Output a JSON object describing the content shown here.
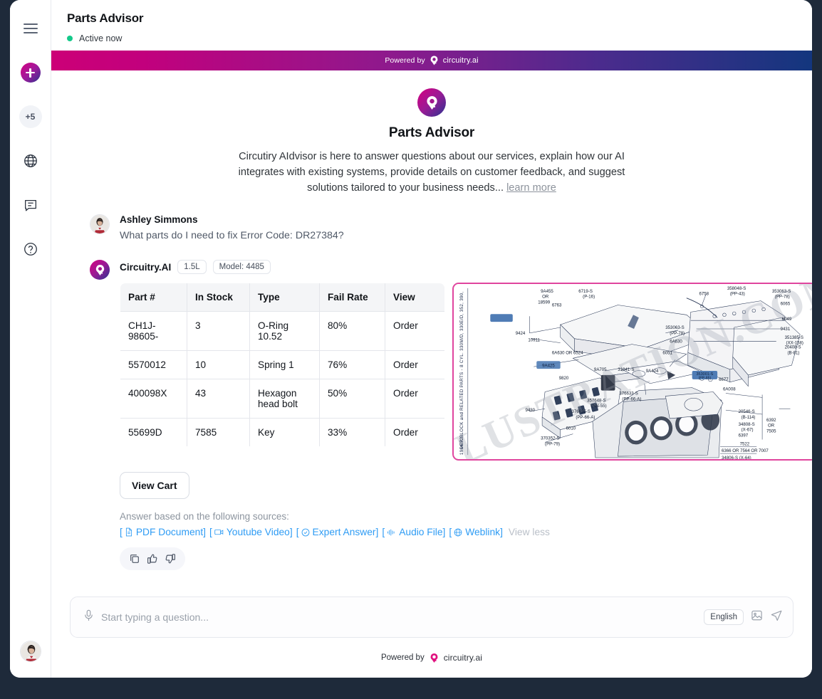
{
  "sidebar": {
    "items": [
      {
        "name": "menu",
        "icon": "hamburger-icon",
        "label": ""
      },
      {
        "name": "new-chat",
        "icon": "plus-icon",
        "label": ""
      },
      {
        "name": "more-count",
        "icon": "count-badge",
        "label": "+5"
      },
      {
        "name": "language",
        "icon": "globe-icon",
        "label": ""
      },
      {
        "name": "conversations",
        "icon": "chat-icon",
        "label": ""
      },
      {
        "name": "help",
        "icon": "help-circle-icon",
        "label": ""
      }
    ],
    "avatar_alt": "user-avatar"
  },
  "header": {
    "title": "Parts Advisor",
    "status": "Active now",
    "status_color": "#14c98a"
  },
  "powered_bar": {
    "text": "Powered by",
    "brand": "circuitry.ai",
    "gradient_start": "#cc0077",
    "gradient_end": "#13367e"
  },
  "intro": {
    "title": "Parts Advisor",
    "description": "Circutiry AIdvisor is here to answer questions about our services, explain how our AI integrates with existing systems, provide details on customer feedback, and suggest solutions tailored to your business needs...",
    "learn_more": "learn more"
  },
  "user_message": {
    "name": "Ashley Simmons",
    "text": "What parts do I need to fix Error Code: DR27384?"
  },
  "bot_message": {
    "name": "Circuitry.AI",
    "badges": [
      "1.5L",
      "Model: 4485"
    ],
    "cart_button": "View Cart",
    "sources_label": "Answer based on the following sources:",
    "view_less": "View less",
    "sources": [
      {
        "label": "PDF Document",
        "icon": "pdf-document-icon"
      },
      {
        "label": "Youtube Video",
        "icon": "video-icon"
      },
      {
        "label": "Expert Answer",
        "icon": "check-circle-icon"
      },
      {
        "label": "Audio File",
        "icon": "audio-wave-icon"
      },
      {
        "label": "Weblink",
        "icon": "globe-icon"
      }
    ],
    "feedback": [
      {
        "name": "copy-icon"
      },
      {
        "name": "thumbs-up-icon"
      },
      {
        "name": "thumbs-down-icon"
      }
    ]
  },
  "parts_table": {
    "columns": [
      "Part #",
      "In Stock",
      "Type",
      "Fail Rate",
      "View"
    ],
    "rows": [
      {
        "part": "CH1J-98605-",
        "stock": "3",
        "stock_color": "#f04437",
        "type": "O-Ring 10.52",
        "fail": "80%",
        "fail_color": "#f04437",
        "view": "Order"
      },
      {
        "part": "5570012",
        "stock": "10",
        "stock_color": "#12161c",
        "type": "Spring 1",
        "fail": "76%",
        "fail_color": "#f04437",
        "view": "Order"
      },
      {
        "part": "400098X",
        "stock": "43",
        "stock_color": "#12161c",
        "type": "Hexagon head bolt",
        "fail": "50%",
        "fail_color": "#f5a524",
        "view": "Order"
      },
      {
        "part": "55699D",
        "stock": "7585",
        "stock_color": "#12161c",
        "type": "Key",
        "fail": "33%",
        "fail_color": "#12a06a",
        "view": "Order"
      }
    ]
  },
  "diagram": {
    "title": "engine-parts-exploded-diagram",
    "side_caption": "DER BLOCK and RELATED PARTS - 8 CYL. 330M/D, 330E/D, 352, 390, 1964/72",
    "watermark": "ILLUSTRATION.COM",
    "border_color": "#e0459e",
    "callouts": [
      "9A455 OR 18599",
      "6763",
      "9424",
      "10911",
      "6A630 OR 6524",
      "9A425",
      "6758",
      "358048-S (PP-43)",
      "353063-S (PP-78)",
      "6065",
      "6049",
      "9431",
      "351385-S (XX-158)",
      "20408-S (B-81)",
      "353063-S (PP-78)",
      "6A630",
      "6051",
      "9A705",
      "31041-S",
      "9A424",
      "353001-S (PP-85)",
      "6677",
      "9820",
      "6A008",
      "376633-S (PP-66-A)",
      "357648-S (NN-55)",
      "9430",
      "376635-S (PP-66-A)",
      "6010",
      "370352-S (PP-79)",
      "20546-S (B-114)",
      "34808-S (X-67)",
      "6392 OR 7505",
      "6397",
      "7522",
      "6366 OR 7564 OR 7007",
      "34806-S (X-64)"
    ]
  },
  "composer": {
    "placeholder": "Start typing a question...",
    "language": "English",
    "mic_icon": "microphone-icon",
    "image_icon": "image-icon",
    "send_icon": "send-icon"
  },
  "footer": {
    "text": "Powered by",
    "brand": "circuitry.ai"
  }
}
